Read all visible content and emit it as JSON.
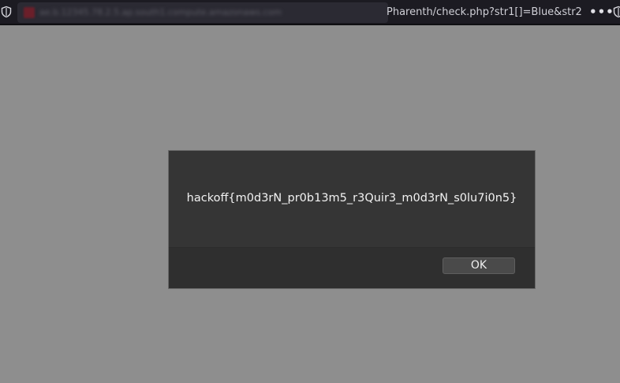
{
  "browser": {
    "url_visible": "Pharenth/check.php?str1[]=Blue&str2",
    "url_blurred": "ae.b.12345.78.2.5.ap.south1.compute.amazonaws.com",
    "menu_icon": "more-dots-icon",
    "left_icon": "shield-icon",
    "right_icon": "shield-icon"
  },
  "dialog": {
    "message": "hackoff{m0d3rN_pr0b13m5_r3Quir3_m0d3rN_s0lu7i0n5}",
    "ok_label": "OK"
  },
  "colors": {
    "page_background": "#8e8e8e",
    "toolbar_background": "#1c1b22",
    "dialog_background": "#353535",
    "dialog_footer": "#2f2f2f",
    "button_background": "#4a4a4a"
  }
}
